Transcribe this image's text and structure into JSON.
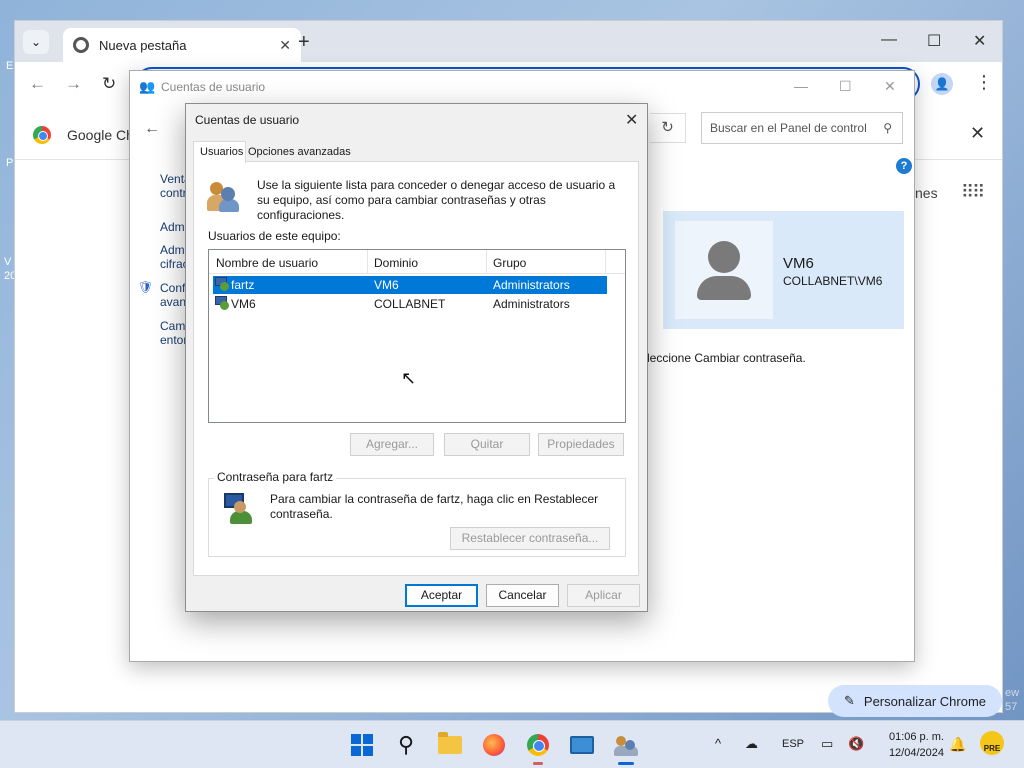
{
  "desktop": {
    "edge_texts": [
      "E",
      "P",
      "V",
      "20",
      "ew",
      "57"
    ]
  },
  "chrome": {
    "tab_title": "Nueva pestaña",
    "infobar_text": "Google Chr",
    "ntp_fragment": "nes",
    "customize_label": "Personalizar Chrome"
  },
  "control_panel": {
    "title": "Cuentas de usuario",
    "search_placeholder": "Buscar en el Panel de control",
    "sidebar": [
      {
        "line1": "Venta",
        "line2": "contra"
      },
      {
        "line1": "Admi",
        "line2": ""
      },
      {
        "line1": "Admi",
        "line2": "cifrac"
      },
      {
        "line1": "Conf",
        "line2": "avanz"
      },
      {
        "line1": "Camb",
        "line2": "entor"
      }
    ],
    "user_name": "VM6",
    "user_domain": "COLLABNET\\VM6",
    "fragment": "leccione Cambiar contraseña."
  },
  "dialog": {
    "title": "Cuentas de usuario",
    "tabs": [
      "Usuarios",
      "Opciones avanzadas"
    ],
    "intro": "Use la siguiente lista para conceder o denegar acceso de usuario a su equipo, así como para cambiar contraseñas y otras configuraciones.",
    "list_label": "Usuarios de este equipo:",
    "columns": [
      "Nombre de usuario",
      "Dominio",
      "Grupo"
    ],
    "rows": [
      {
        "name": "fartz",
        "domain": "VM6",
        "group": "Administrators"
      },
      {
        "name": "VM6",
        "domain": "COLLABNET",
        "group": "Administrators"
      }
    ],
    "buttons": {
      "add": "Agregar...",
      "remove": "Quitar",
      "properties": "Propiedades"
    },
    "password_group_label": "Contraseña para fartz",
    "password_text": "Para cambiar la contraseña de fartz, haga clic en Restablecer contraseña.",
    "reset_button": "Restablecer contraseña...",
    "ok": "Aceptar",
    "cancel": "Cancelar",
    "apply": "Aplicar"
  },
  "taskbar": {
    "language": "ESP",
    "time": "01:06 p. m.",
    "date": "12/04/2024",
    "badge": "PRE"
  }
}
